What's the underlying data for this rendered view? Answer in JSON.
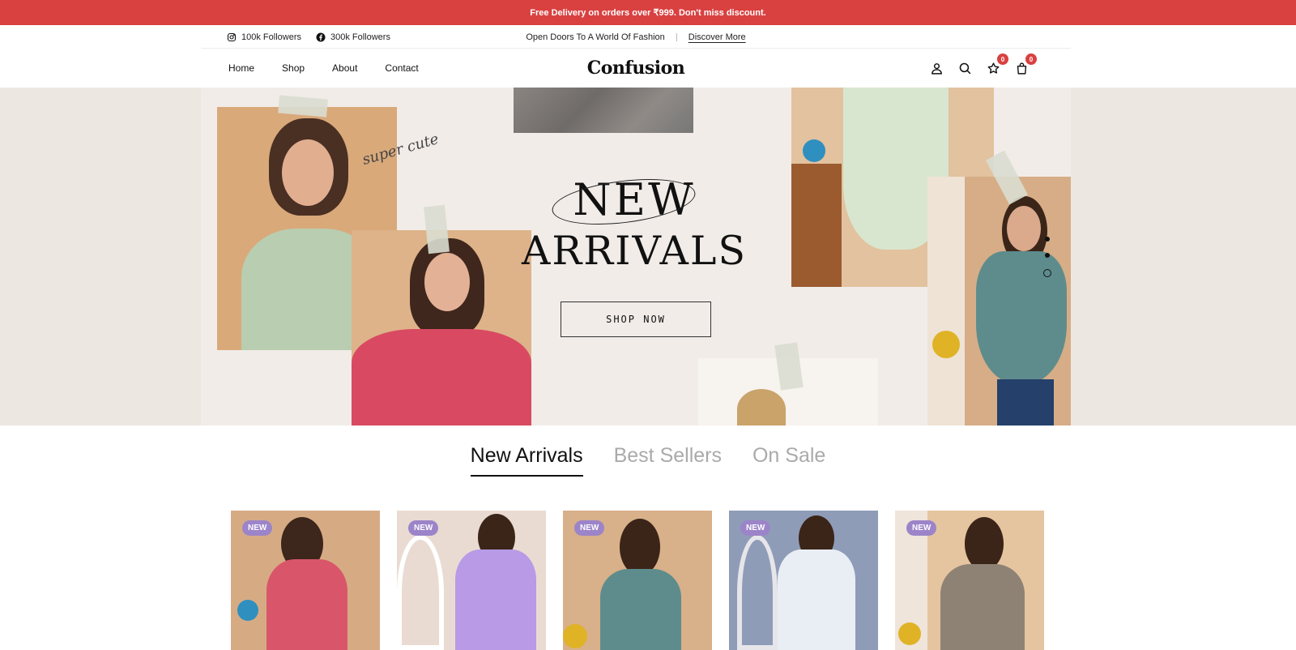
{
  "announcement": {
    "text": "Free Delivery on orders over ₹999. Don't miss discount."
  },
  "topbar": {
    "instagram": {
      "icon": "instagram-icon",
      "label": "100k Followers"
    },
    "facebook": {
      "icon": "facebook-icon",
      "label": "300k Followers"
    },
    "promo_text": "Open Doors To A World Of Fashion",
    "promo_link": "Discover More"
  },
  "nav": {
    "menu": [
      "Home",
      "Shop",
      "About",
      "Contact"
    ],
    "logo": "Confusion",
    "wishlist_count": "0",
    "cart_count": "0",
    "icons": [
      "user-icon",
      "search-icon",
      "star-icon",
      "bag-icon"
    ]
  },
  "hero": {
    "script_text": "super cute",
    "title_line1": "NEW",
    "title_line2": "ARRIVALS",
    "button": "SHOP NOW",
    "slides": 3,
    "active_slide": 3
  },
  "tabs": [
    {
      "label": "New Arrivals",
      "active": true
    },
    {
      "label": "Best Sellers",
      "active": false
    },
    {
      "label": "On Sale",
      "active": false
    }
  ],
  "products": [
    {
      "badge": "NEW"
    },
    {
      "badge": "NEW"
    },
    {
      "badge": "NEW"
    },
    {
      "badge": "NEW"
    },
    {
      "badge": "NEW"
    }
  ],
  "colors": {
    "accent": "#d94141",
    "badge": "#9c84c9"
  }
}
